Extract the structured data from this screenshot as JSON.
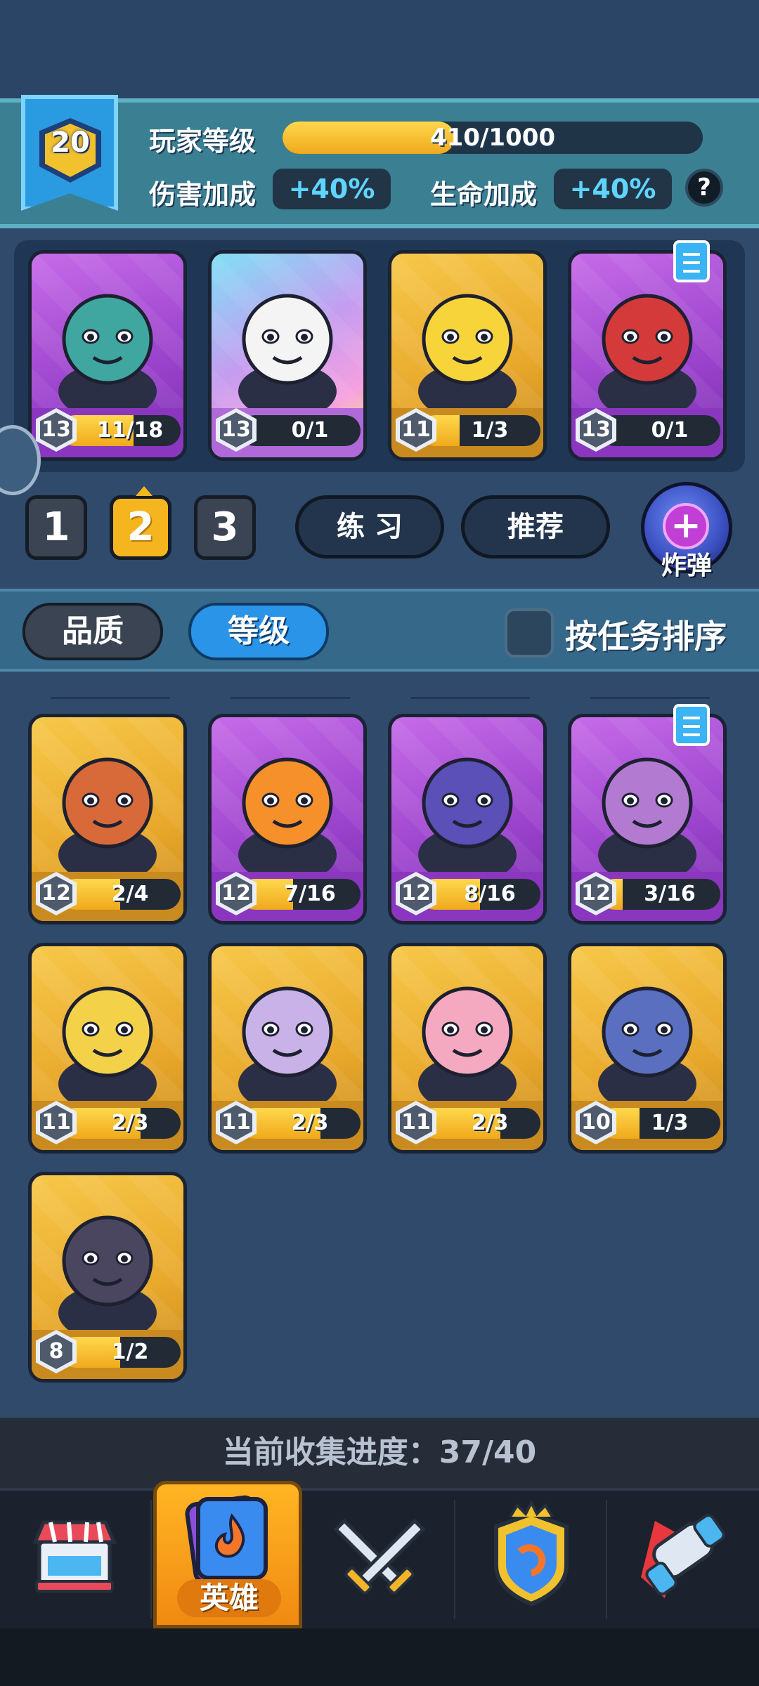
{
  "player": {
    "rank": "20",
    "level_label": "玩家等级",
    "xp_text": "410/1000",
    "xp_fraction": 0.41,
    "damage_label": "伤害加成",
    "damage_value": "+40%",
    "health_label": "生命加成",
    "health_value": "+40%",
    "help_symbol": "?"
  },
  "deck": [
    {
      "name": "ogre-hook-hero",
      "rarity": "purple",
      "level": "13",
      "progress": "11/18",
      "fraction": 0.61,
      "icon": "ogre-icon",
      "color": "#3fa7a0"
    },
    {
      "name": "panda-hero",
      "rarity": "rainbow",
      "level": "13",
      "progress": "0/1",
      "fraction": 0.0,
      "icon": "panda-icon",
      "color": "#f4f4f4"
    },
    {
      "name": "rooster-boxer-hero",
      "rarity": "gold",
      "level": "11",
      "progress": "1/3",
      "fraction": 0.33,
      "icon": "rooster-icon",
      "color": "#f7d53a"
    },
    {
      "name": "samurai-hero",
      "rarity": "purple",
      "level": "13",
      "progress": "0/1",
      "fraction": 0.0,
      "icon": "samurai-icon",
      "color": "#d43a3a",
      "task": true
    }
  ],
  "pages": [
    "1",
    "2",
    "3"
  ],
  "active_page": 1,
  "buttons": {
    "practice": "练 习",
    "recommend": "推荐",
    "bomb": "炸弹",
    "bomb_symbol": "+"
  },
  "filters": {
    "quality": "品质",
    "level": "等级",
    "sort_by_task": "按任务排序"
  },
  "collection": [
    {
      "name": "tribal-girl-hero",
      "rarity": "gold",
      "level": "12",
      "progress": "2/4",
      "fraction": 0.5,
      "icon": "tribal-girl-icon",
      "color": "#d86a3a"
    },
    {
      "name": "fire-imp-hero",
      "rarity": "purple",
      "level": "12",
      "progress": "7/16",
      "fraction": 0.44,
      "icon": "fire-imp-icon",
      "color": "#f5902a"
    },
    {
      "name": "minotaur-hero",
      "rarity": "purple",
      "level": "12",
      "progress": "8/16",
      "fraction": 0.5,
      "icon": "minotaur-icon",
      "color": "#5b4fb8"
    },
    {
      "name": "banana-gorilla-hero",
      "rarity": "purple",
      "level": "12",
      "progress": "3/16",
      "fraction": 0.19,
      "icon": "gorilla-icon",
      "color": "#b27ad0",
      "task": true
    },
    {
      "name": "knight-hero",
      "rarity": "gold",
      "level": "11",
      "progress": "2/3",
      "fraction": 0.67,
      "icon": "knight-icon",
      "color": "#f3d24a"
    },
    {
      "name": "dark-elf-hero",
      "rarity": "gold",
      "level": "11",
      "progress": "2/3",
      "fraction": 0.67,
      "icon": "elf-icon",
      "color": "#c9b2e8"
    },
    {
      "name": "kitsune-girl-hero",
      "rarity": "gold",
      "level": "11",
      "progress": "2/3",
      "fraction": 0.67,
      "icon": "kitsune-icon",
      "color": "#f5a9c0"
    },
    {
      "name": "shadow-creature-hero",
      "rarity": "gold",
      "level": "10",
      "progress": "1/3",
      "fraction": 0.33,
      "icon": "shadow-icon",
      "color": "#5a6fc0"
    },
    {
      "name": "wolf-hero",
      "rarity": "gold",
      "level": "8",
      "progress": "1/2",
      "fraction": 0.5,
      "icon": "wolf-icon",
      "color": "#4a4660"
    }
  ],
  "collection_progress": "当前收集进度：37/40",
  "nav": {
    "shop_icon": "shop-icon",
    "heroes_label": "英雄",
    "battle_icon": "crossed-swords-icon",
    "clan_icon": "shield-emblem-icon",
    "events_icon": "cannon-icon"
  },
  "colors": {
    "accent_gold": "#f5b51e",
    "accent_blue": "#2a94e8",
    "bonus_text": "#5fd4ff"
  }
}
